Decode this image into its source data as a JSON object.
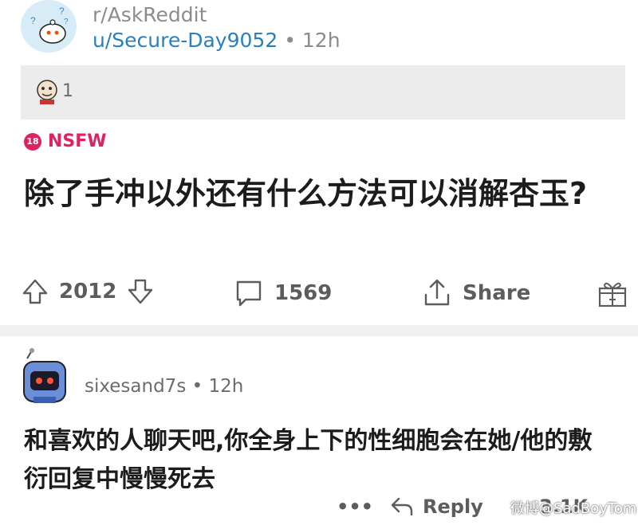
{
  "post": {
    "subreddit": "r/AskReddit",
    "author": "u/Secure-Day9052",
    "time_sep": "•",
    "time": "12h",
    "award_count": "1",
    "nsfw_badge": "18",
    "nsfw_label": "NSFW",
    "title": "除了手冲以外还有什么方法可以消解杏玉?",
    "upvotes": "2012",
    "comments": "1569",
    "share_label": "Share"
  },
  "comment": {
    "author": "sixesand7s",
    "time_sep": "•",
    "time": "12h",
    "body": "和喜欢的人聊天吧,你全身上下的性细胞会在她/他的敷衍回复中慢慢死去",
    "more": "•••",
    "reply_label": "Reply",
    "vote_count": "3.1K"
  },
  "watermark": "微博@SadBoyTom",
  "colors": {
    "link_blue": "#2a7fbf",
    "nsfw_pink": "#e0215f",
    "meta_gray": "#8a8c8e",
    "award_bar": "#ececec"
  },
  "icons": [
    "subreddit-avatar-icon",
    "award-icon",
    "upvote-icon",
    "downvote-icon",
    "comment-icon",
    "share-icon",
    "gift-icon",
    "user-avatar-icon",
    "reply-icon"
  ]
}
